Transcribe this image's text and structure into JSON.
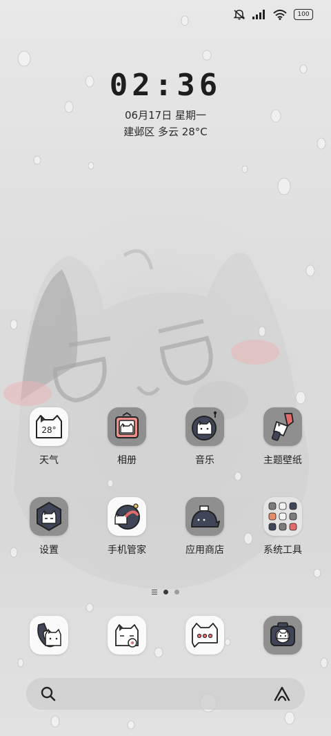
{
  "status_bar": {
    "battery": "100",
    "icons": [
      "mute-icon",
      "signal-icon",
      "wifi-icon",
      "battery-icon"
    ]
  },
  "lockscreen": {
    "time": "02:36",
    "date": "06月17日 星期一",
    "weather": "建邺区 多云 28°C"
  },
  "apps_row1": [
    {
      "label": "天气",
      "icon": "weather-cat-icon"
    },
    {
      "label": "相册",
      "icon": "gallery-cat-icon"
    },
    {
      "label": "音乐",
      "icon": "music-cat-icon"
    },
    {
      "label": "主题壁纸",
      "icon": "theme-brush-icon"
    }
  ],
  "apps_row2": [
    {
      "label": "设置",
      "icon": "settings-cat-icon"
    },
    {
      "label": "手机管家",
      "icon": "security-cat-icon"
    },
    {
      "label": "应用商店",
      "icon": "store-cat-icon"
    },
    {
      "label": "系统工具",
      "icon": "folder-icon"
    }
  ],
  "weather_icon_text": "28°",
  "page_indicator": {
    "pages": 2,
    "active": 0
  },
  "dock": [
    {
      "icon": "phone-cat-icon"
    },
    {
      "icon": "contacts-cat-icon"
    },
    {
      "icon": "messages-cat-icon"
    },
    {
      "icon": "camera-cat-icon"
    }
  ],
  "search_bar": {
    "left_icon": "search-icon",
    "right_icon": "assistant-icon"
  }
}
